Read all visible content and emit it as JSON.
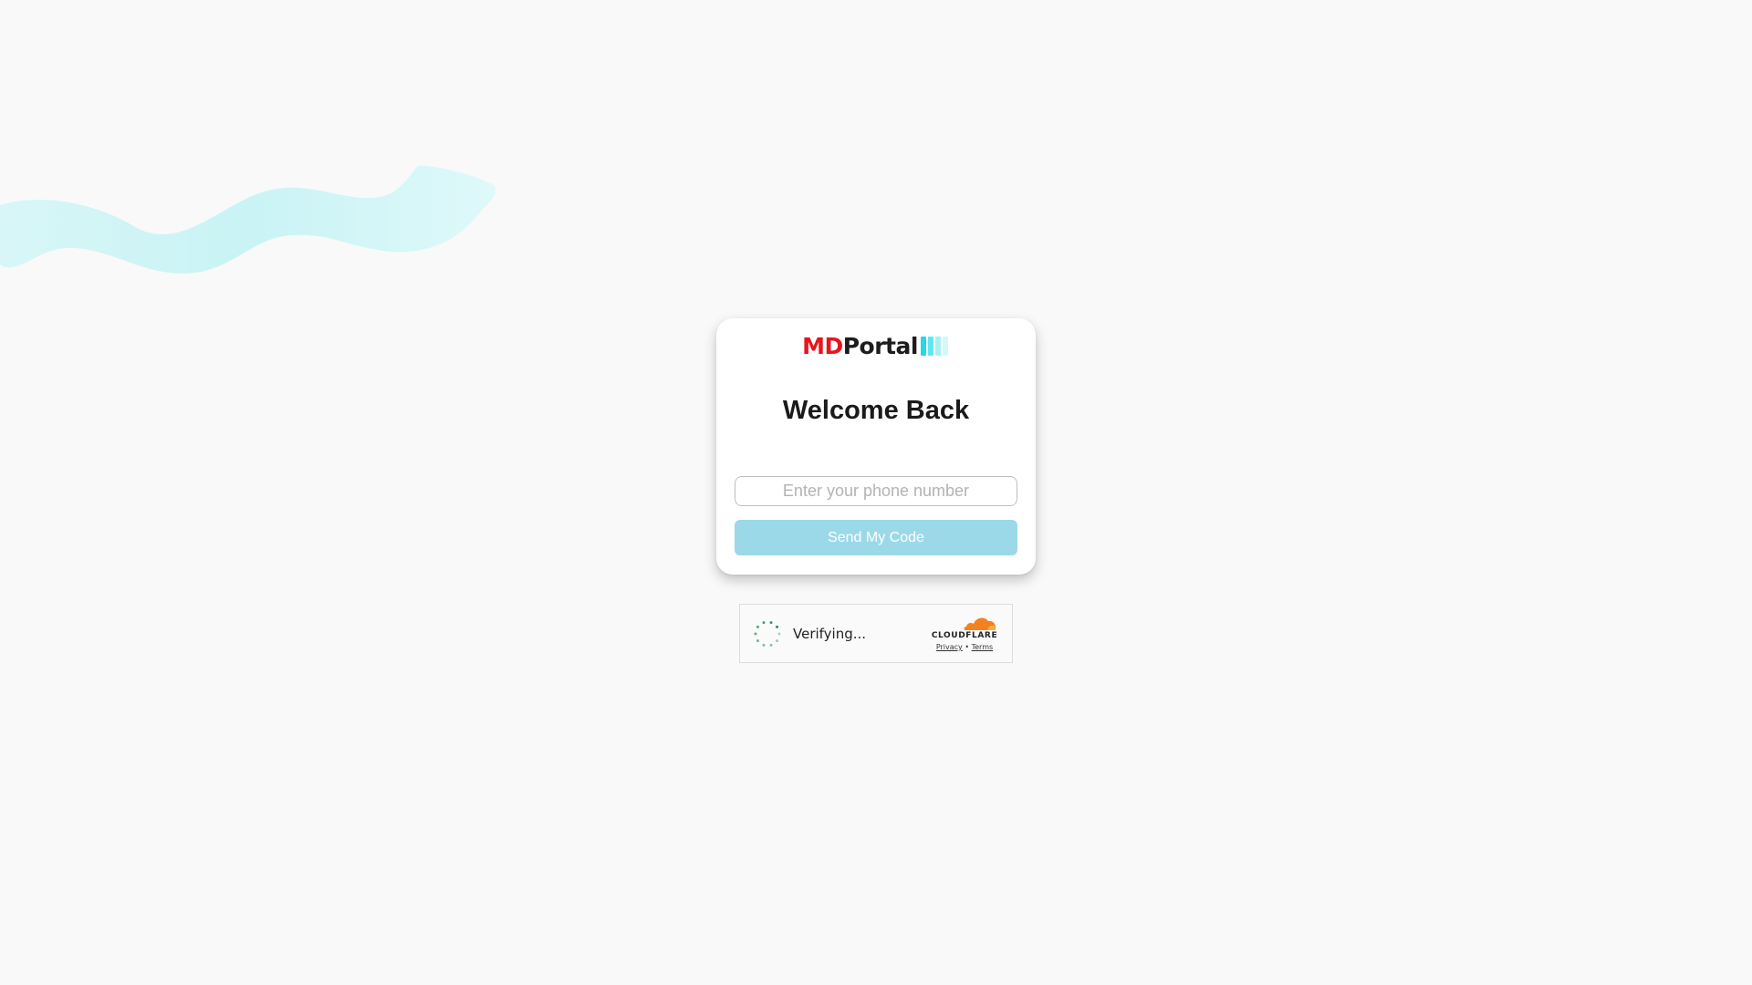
{
  "brand": {
    "logo_md": "MD",
    "logo_portal": "Portal",
    "bar_colors": [
      "#26d7e6",
      "#5fe6ef",
      "#a6f1f6",
      "#d4f8fa"
    ]
  },
  "login": {
    "title": "Welcome Back",
    "phone_placeholder": "Enter your phone number",
    "phone_value": "",
    "send_button_label": "Send My Code"
  },
  "captcha": {
    "status_text": "Verifying...",
    "provider_name": "CLOUDFLARE",
    "privacy_label": "Privacy",
    "separator": "•",
    "terms_label": "Terms",
    "spinner_color": "#1c8b4c",
    "cloud_color": "#f48120"
  },
  "colors": {
    "background": "#f9f9f9",
    "accent_button": "#9cd9e8",
    "wave": "#cdf5f6",
    "brand_red": "#e8141d"
  }
}
